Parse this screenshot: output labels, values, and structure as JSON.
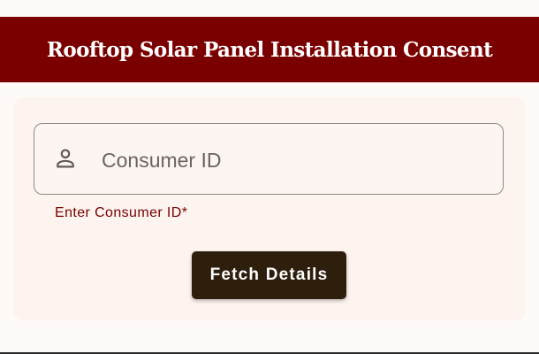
{
  "header": {
    "title": "Rooftop Solar Panel Installation Consent"
  },
  "form": {
    "consumer_id": {
      "placeholder": "Consumer ID",
      "value": "",
      "helper_text": "Enter Consumer ID*",
      "icon": "person-icon"
    },
    "fetch_button_label": "Fetch Details"
  },
  "colors": {
    "header_background": "#7a0000",
    "card_background": "#fdf3ef",
    "button_background": "#2e1f0d",
    "helper_text": "#7a0000"
  }
}
